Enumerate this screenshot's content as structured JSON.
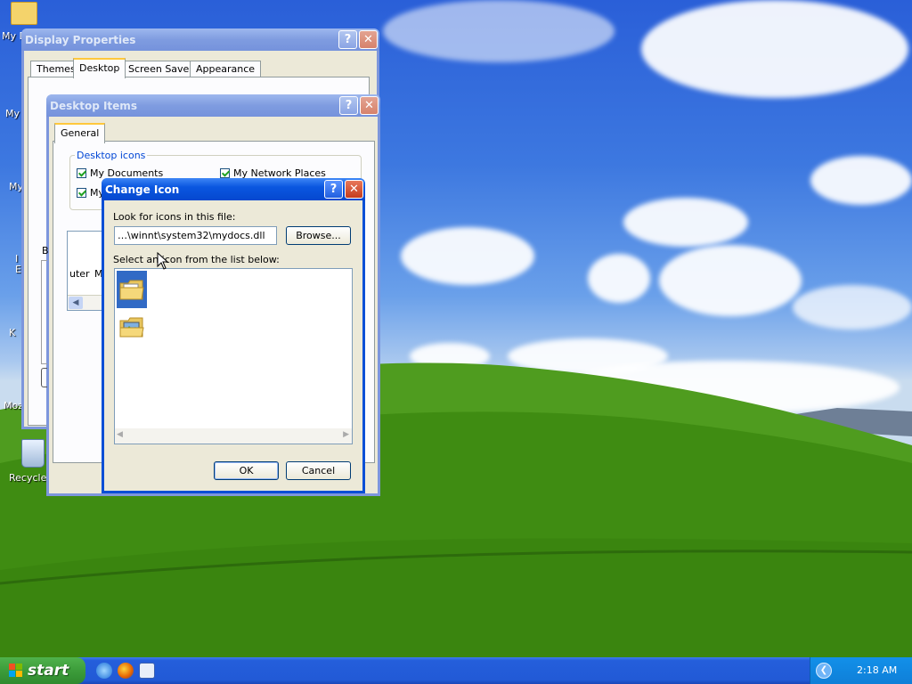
{
  "desktop": {
    "icons": [
      {
        "label": "My D"
      },
      {
        "label": "My"
      },
      {
        "label": "My"
      },
      {
        "label": "I\nE"
      },
      {
        "label": "K"
      },
      {
        "label": "Moz"
      },
      {
        "label": "Recycle"
      }
    ]
  },
  "display_properties": {
    "title": "Display Properties",
    "tabs": [
      "Themes",
      "Desktop",
      "Screen Saver",
      "Appearance"
    ],
    "active_tab": "Desktop"
  },
  "desktop_items": {
    "title": "Desktop Items",
    "tab": "General",
    "group_label": "Desktop icons",
    "checkboxes": [
      {
        "label": "My Documents",
        "checked": true
      },
      {
        "label": "My Network Places",
        "checked": true
      },
      {
        "label": "My",
        "checked": true
      }
    ],
    "partial_b": "B",
    "list_labels": [
      "uter",
      "M"
    ]
  },
  "change_icon": {
    "title": "Change Icon",
    "file_label": "Look for icons in this file:",
    "file_value": "…\\winnt\\system32\\mydocs.dll",
    "browse_label": "Browse...",
    "list_label": "Select an icon from the list below:",
    "icons": [
      "folder-documents-icon",
      "folder-pictures-icon"
    ],
    "ok_label": "OK",
    "cancel_label": "Cancel"
  },
  "taskbar": {
    "start_label": "start",
    "quick_launch": [
      "ie-icon",
      "firefox-icon",
      "app-icon"
    ],
    "clock": "2:18 AM"
  }
}
